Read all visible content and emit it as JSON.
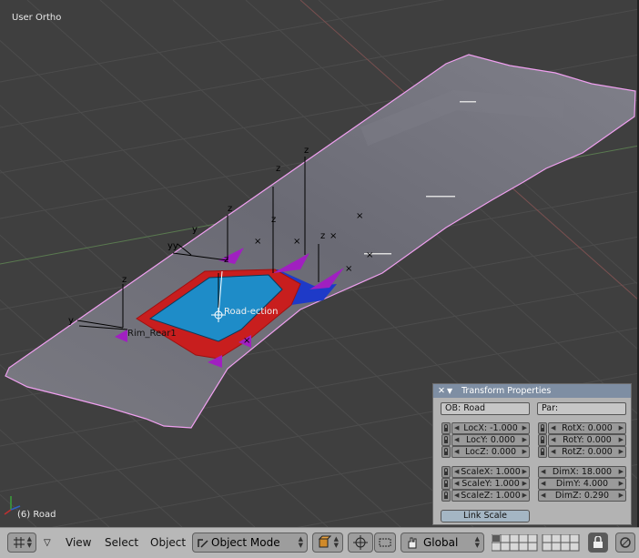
{
  "viewport": {
    "view_name": "User Ortho",
    "object_status": "(6) Road",
    "labels": {
      "road_section": "Road-ection",
      "rim_rear": "Rim_Rear1"
    }
  },
  "transform_panel": {
    "title": "Transform Properties",
    "object_name": "OB: Road",
    "parent": "Par:",
    "loc": [
      "LocX: -1.000",
      "LocY: 0.000",
      "LocZ: 0.000"
    ],
    "rot": [
      "RotX: 0.000",
      "RotY: 0.000",
      "RotZ: 0.000"
    ],
    "scale": [
      "ScaleX: 1.000",
      "ScaleY: 1.000",
      "ScaleZ: 1.000"
    ],
    "dim": [
      "DimX: 18.000",
      "DimY: 4.000",
      "DimZ: 0.290"
    ],
    "link_scale": "Link Scale"
  },
  "header": {
    "menus": [
      "View",
      "Select",
      "Object"
    ],
    "mode": "Object Mode",
    "orientation": "Global"
  },
  "colors": {
    "viewport_bg": "#3f3f3f",
    "panel_bg": "#b3b3b3",
    "panel_header": "#7e8ea3",
    "road_surface": "#6e6e78",
    "selected_outline": "#f0a0f0",
    "car_body": "#c81e1e",
    "car_top": "#1e8cc8",
    "wheel": "#a020c0"
  },
  "icons": [
    "editor-type-icon",
    "lock-icon",
    "pivot-icon",
    "manipulator-icon",
    "hand-icon",
    "layer-buttons",
    "close-icon",
    "triangle-icon"
  ]
}
